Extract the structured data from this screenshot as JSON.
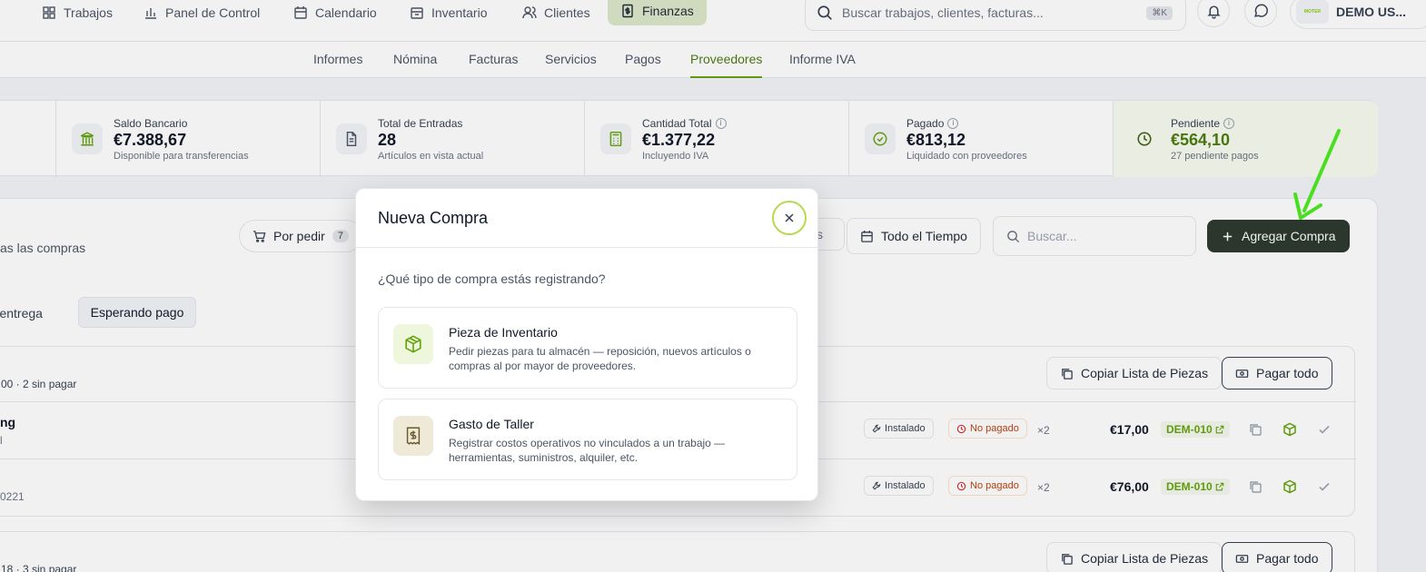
{
  "topnav": {
    "items": [
      {
        "label": "Trabajos",
        "icon": "grid-icon"
      },
      {
        "label": "Panel de Control",
        "icon": "bar-chart-icon"
      },
      {
        "label": "Calendario",
        "icon": "calendar-icon"
      },
      {
        "label": "Inventario",
        "icon": "archive-icon"
      },
      {
        "label": "Clientes",
        "icon": "users-icon"
      },
      {
        "label": "Finanzas",
        "icon": "dollar-file-icon"
      }
    ],
    "search_placeholder": "Buscar trabajos, clientes, facturas...",
    "search_shortcut": "⌘K",
    "user_label": "DEMO US...",
    "avatar_text": "MOTER"
  },
  "subnav": {
    "tabs": [
      "Informes",
      "Nómina",
      "Facturas",
      "Servicios",
      "Pagos",
      "Proveedores",
      "Informe IVA"
    ],
    "active": "Proveedores"
  },
  "stats": [
    {
      "label": "Saldo Bancario",
      "value": "€7.388,67",
      "sub": "Disponible para transferencias"
    },
    {
      "label": "Total de Entradas",
      "value": "28",
      "sub": "Artículos en vista actual"
    },
    {
      "label": "Cantidad Total",
      "value": "€1.377,22",
      "sub": "Incluyendo IVA"
    },
    {
      "label": "Pagado",
      "value": "€813,12",
      "sub": "Liquidado con proveedores"
    },
    {
      "label": "Pendiente",
      "value": "€564,10",
      "sub": "27 pendiente pagos"
    }
  ],
  "panel": {
    "subtitle_fragment": "as las compras",
    "filter_por_pedir": "Por pedir",
    "filter_por_pedir_count": "7",
    "filter_fragment": "s",
    "filter_time": "Todo el Tiempo",
    "search_placeholder": "Buscar...",
    "add_button": "Agregar Compra",
    "seg_fragment": "do entrega",
    "seg_active": "Esperando pago",
    "group1_head": "00 · 2 sin pagar",
    "group2_head": "18 · 3 sin pagar",
    "copy_parts": "Copiar Lista de Piezas",
    "pay_all": "Pagar todo",
    "rows": [
      {
        "name_fragment": "ng",
        "sub_fragment": "l",
        "status1": "Instalado",
        "status2": "No pagado",
        "qty": "×2",
        "price": "€17,00",
        "ref": "DEM-010"
      },
      {
        "name_fragment": "",
        "sub_fragment": "0221",
        "status1": "Instalado",
        "status2": "No pagado",
        "qty": "×2",
        "price": "€76,00",
        "ref": "DEM-010"
      }
    ]
  },
  "modal": {
    "title": "Nueva Compra",
    "question": "¿Qué tipo de compra estás registrando?",
    "options": [
      {
        "title": "Pieza de Inventario",
        "desc": "Pedir piezas para tu almacén — reposición, nuevos artículos o compras al por mayor de proveedores.",
        "icon": "package-icon"
      },
      {
        "title": "Gasto de Taller",
        "desc": "Registrar costos operativos no vinculados a un trabajo — herramientas, suministros, alquiler, etc.",
        "icon": "receipt-icon"
      }
    ]
  },
  "colors": {
    "accent_green": "#65a30d",
    "dark_button": "#2d3a2e",
    "arrow": "#4ade20"
  }
}
